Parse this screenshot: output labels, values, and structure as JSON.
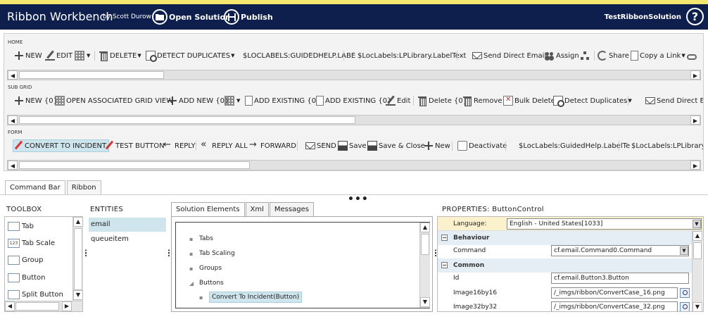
{
  "header": {
    "title": "Ribbon Workbench",
    "byline": "by Scott Durow",
    "open_solution": "Open Solution",
    "publish": "Publish",
    "solution_name": "TestRibbonSolution",
    "help": "?"
  },
  "ribbon": {
    "home": {
      "label": "HOME",
      "new": "NEW",
      "edit": "EDIT",
      "delete": "DELETE",
      "detect_duplicates": "DETECT DUPLICATES",
      "loclabel_guided": "$LOCLABELS:GUIDEDHELP.LABE",
      "loclabel_library": "$LocLabels:LPLibrary.LabelText",
      "send_direct_email": "Send Direct Email",
      "assign": "Assign",
      "share": "Share",
      "copy_link": "Copy a Link"
    },
    "subgrid": {
      "label": "SUB GRID",
      "new": "NEW {0}",
      "open_associated": "OPEN ASSOCIATED GRID VIEW",
      "add_new": "ADD NEW {0}",
      "add_existing_1": "ADD EXISTING {0}",
      "add_existing_2": "ADD EXISTING {0}",
      "edit": "Edit",
      "delete": "Delete {0}",
      "remove": "Remove",
      "bulk_delete": "Bulk Delete",
      "detect_duplicates": "Detect Duplicates",
      "send_direct": "Send Direct E"
    },
    "form": {
      "label": "FORM",
      "convert_to_incident": "CONVERT TO INCIDENT",
      "test_button": "TEST BUTTON",
      "reply": "REPLY",
      "reply_all": "REPLY ALL",
      "forward": "FORWARD",
      "send": "SEND",
      "save": "Save",
      "save_close": "Save & Close",
      "new": "New",
      "deactivate": "Deactivate",
      "loclabel_guided": "$LocLabels:GuidedHelp.LabelTe",
      "loclabel_library": "$LocLabels:LPLibrary.L"
    }
  },
  "view_tabs": [
    "Command Bar",
    "Ribbon"
  ],
  "toolbox": {
    "title": "TOOLBOX",
    "items": [
      {
        "label": "Tab",
        "icon": "tab-icon"
      },
      {
        "label": "Tab Scale",
        "icon": "tab-scale-icon",
        "glyph": "123"
      },
      {
        "label": "Group",
        "icon": "group-icon"
      },
      {
        "label": "Button",
        "icon": "button-icon"
      },
      {
        "label": "Split Button",
        "icon": "split-button-icon"
      }
    ]
  },
  "entities": {
    "title": "ENTITIES",
    "items": [
      "email",
      "queueitem"
    ],
    "selected": "email"
  },
  "solution": {
    "tabs": [
      "Solution Elements",
      "Xml",
      "Messages"
    ],
    "tree": {
      "tabs": "Tabs",
      "tab_scaling": "Tab Scaling",
      "groups": "Groups",
      "buttons": "Buttons",
      "convert": "Convert To Incident(Button)"
    }
  },
  "properties": {
    "title": "PROPERTIES: ButtonControl",
    "language_label": "Language:",
    "language_value": "English - United States[1033]",
    "behaviour_group": "Behaviour",
    "command_label": "Command",
    "command_value": "cf.email.Command0.Command",
    "common_group": "Common",
    "id_label": "Id",
    "id_value": "cf.email.Button3.Button",
    "image16_label": "Image16by16",
    "image16_value": "/_imgs/ribbon/ConvertCase_16.png",
    "image32_label": "Image32by32",
    "image32_value": "/_imgs/ribbon/ConvertCase_32.png"
  }
}
